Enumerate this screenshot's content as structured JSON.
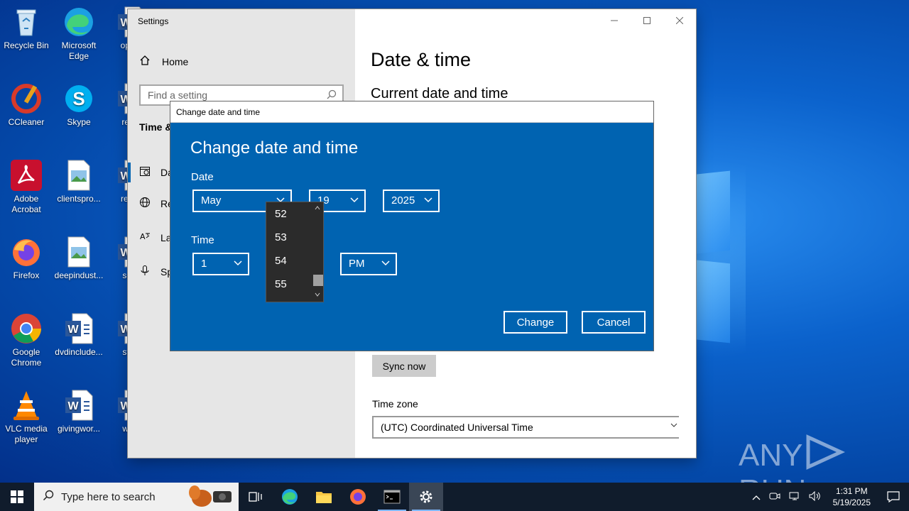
{
  "desktop": {
    "icons": [
      {
        "label": "Recycle Bin",
        "icon": "recycle-bin-icon"
      },
      {
        "label": "Microsoft Edge",
        "icon": "edge-icon"
      },
      {
        "label": "opera",
        "icon": "word-doc-icon"
      },
      {
        "label": "CCleaner",
        "icon": "ccleaner-icon"
      },
      {
        "label": "Skype",
        "icon": "skype-icon"
      },
      {
        "label": "remo",
        "icon": "word-doc-icon"
      },
      {
        "label": "Adobe Acrobat",
        "icon": "acrobat-icon"
      },
      {
        "label": "clientspro...",
        "icon": "image-file-icon"
      },
      {
        "label": "respo",
        "icon": "word-doc-icon"
      },
      {
        "label": "Firefox",
        "icon": "firefox-icon"
      },
      {
        "label": "deepindust...",
        "icon": "image-file-icon"
      },
      {
        "label": "servi",
        "icon": "word-doc-icon"
      },
      {
        "label": "Google Chrome",
        "icon": "chrome-icon"
      },
      {
        "label": "dvdinclude...",
        "icon": "word-doc-icon"
      },
      {
        "label": "steel",
        "icon": "word-doc-icon"
      },
      {
        "label": "VLC media player",
        "icon": "vlc-icon"
      },
      {
        "label": "givingwor...",
        "icon": "word-doc-icon"
      },
      {
        "label": "wnat",
        "icon": "word-doc-icon"
      }
    ],
    "watermark": {
      "left": "ANY",
      "right": "RUN"
    }
  },
  "settings": {
    "window_title": "Settings",
    "home_label": "Home",
    "search_placeholder": "Find a setting",
    "section_title": "Time &",
    "nav": [
      {
        "label": "Da",
        "icon": "calendar-icon"
      },
      {
        "label": "Re",
        "icon": "globe-icon"
      },
      {
        "label": "La",
        "icon": "language-icon"
      },
      {
        "label": "Sp",
        "icon": "microphone-icon"
      }
    ],
    "page_title": "Date & time",
    "section_heading": "Current date and time",
    "sync_button": "Sync now",
    "timezone_label": "Time zone",
    "timezone_value": "(UTC) Coordinated Universal Time"
  },
  "dialog": {
    "title": "Change date and time",
    "heading": "Change date and time",
    "date_label": "Date",
    "month": "May",
    "day": "19",
    "year": "2025",
    "time_label": "Time",
    "hour": "1",
    "ampm": "PM",
    "change_button": "Change",
    "cancel_button": "Cancel",
    "minute_options": [
      "52",
      "53",
      "54",
      "55"
    ]
  },
  "taskbar": {
    "search_placeholder": "Type here to search",
    "time": "1:31 PM",
    "date": "5/19/2025"
  },
  "colors": {
    "dialog_blue": "#0063b1",
    "taskbar": "#101c2c"
  }
}
